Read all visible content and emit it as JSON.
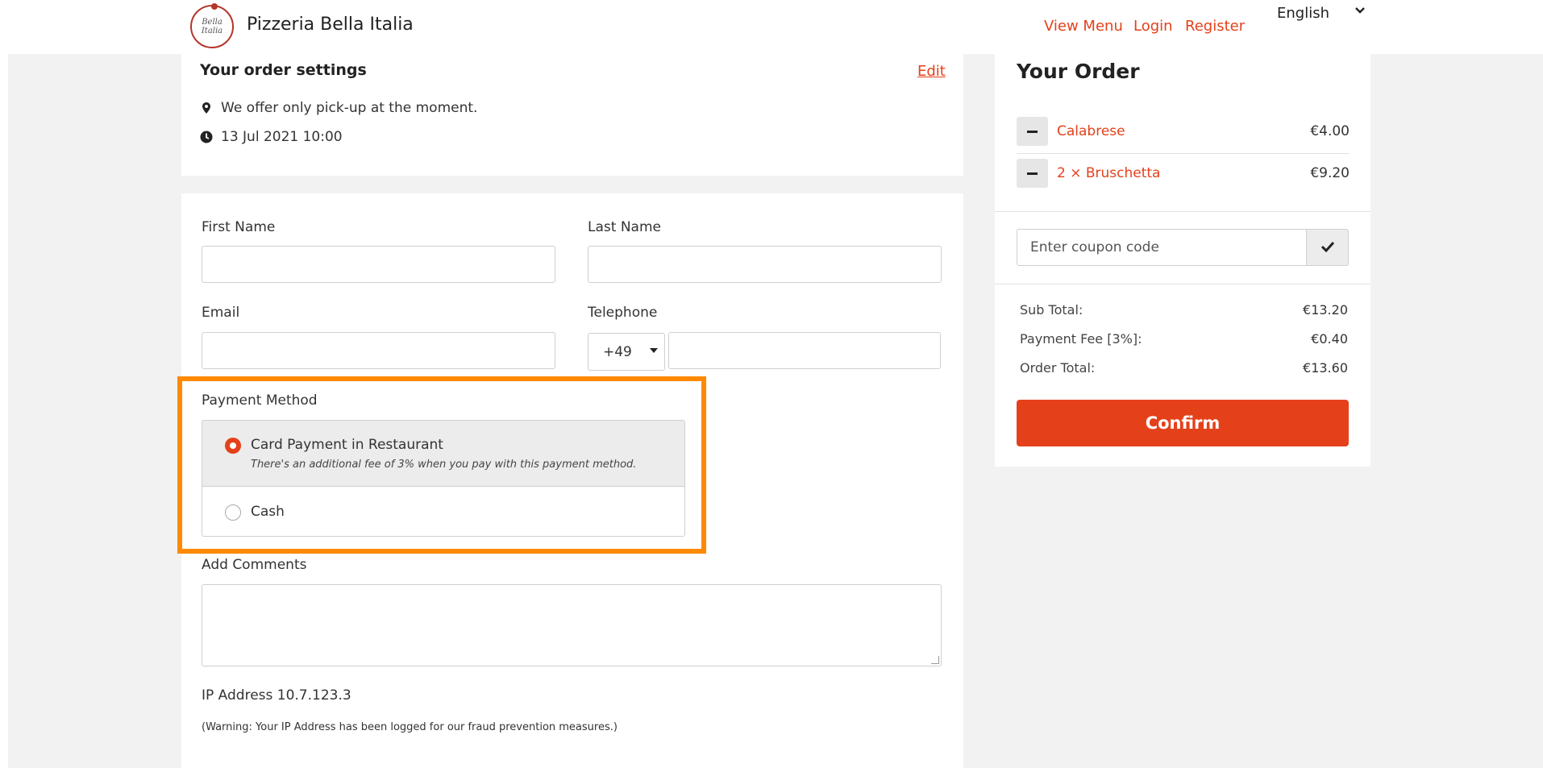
{
  "header": {
    "brand_name": "Pizzeria Bella Italia",
    "logo_text": "Bella Italia",
    "nav": {
      "menu": "View Menu",
      "login": "Login",
      "register": "Register"
    },
    "language": "English"
  },
  "order_settings": {
    "title": "Your order settings",
    "edit_label": "Edit",
    "pickup_note": "We offer only pick-up at the moment.",
    "datetime": "13 Jul 2021 10:00"
  },
  "form": {
    "first_name_label": "First Name",
    "last_name_label": "Last Name",
    "email_label": "Email",
    "telephone_label": "Telephone",
    "country_code": "+49",
    "payment_method_label": "Payment Method",
    "payment_options": [
      {
        "label": "Card Payment in Restaurant",
        "note": "There's an additional fee of 3% when you pay with this payment method.",
        "selected": true
      },
      {
        "label": "Cash",
        "selected": false
      }
    ],
    "comments_label": "Add Comments",
    "ip_address": "IP Address 10.7.123.3",
    "ip_warning": "(Warning: Your IP Address has been logged for our fraud prevention measures.)"
  },
  "order": {
    "title": "Your Order",
    "items": [
      {
        "name": "Calabrese",
        "price": "€4.00"
      },
      {
        "name": "2 × Bruschetta",
        "price": "€9.20"
      }
    ],
    "coupon_placeholder": "Enter coupon code",
    "summary": [
      {
        "label": "Sub Total:",
        "value": "€13.20"
      },
      {
        "label": "Payment Fee [3%]:",
        "value": "€0.40"
      },
      {
        "label": "Order Total:",
        "value": "€13.60"
      }
    ],
    "confirm_label": "Confirm"
  },
  "colors": {
    "accent": "#e4411b",
    "highlight": "#ff8a00",
    "background": "#f2f2f2"
  }
}
